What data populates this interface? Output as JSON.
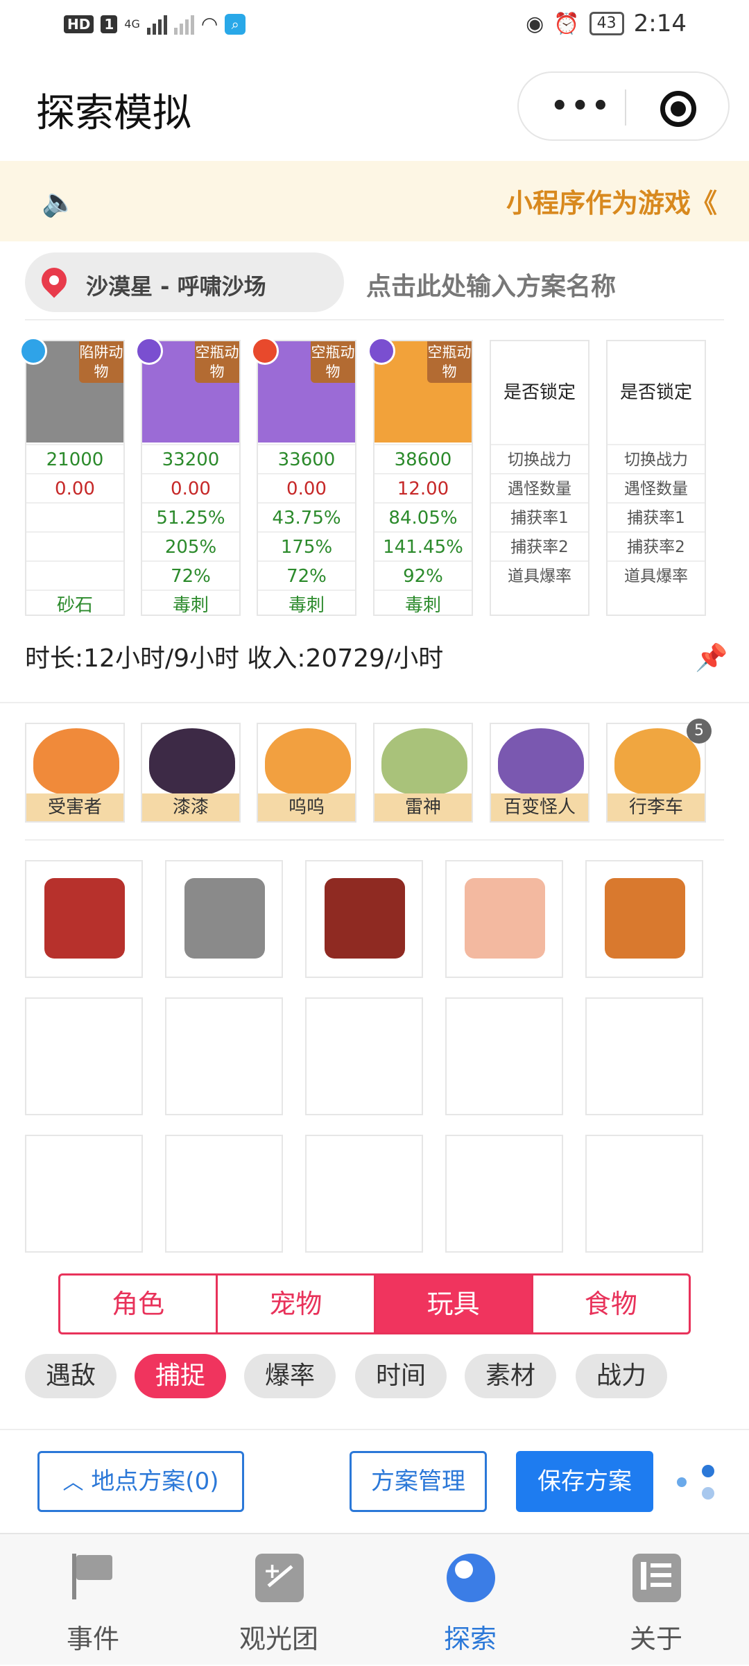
{
  "status": {
    "time": "2:14",
    "battery": "43",
    "hd": "HD",
    "sim": "1",
    "net": "4G"
  },
  "title": "探索模拟",
  "banner": {
    "text": "小程序作为游戏《"
  },
  "location": {
    "label": "沙漠星 - 呼啸沙场",
    "plan_placeholder": "点击此处输入方案名称"
  },
  "pets": [
    {
      "tag": "陷阱动物",
      "power": "21000",
      "v1": "0.00",
      "v2": "",
      "v3": "",
      "v4": "",
      "item": "砂石",
      "elem_color": "#2fa3e8",
      "bg": "#8a8a8a"
    },
    {
      "tag": "空瓶动物",
      "power": "33200",
      "v1": "0.00",
      "v2": "51.25%",
      "v3": "205%",
      "v4": "72%",
      "item": "毒刺",
      "elem_color": "#7a4fd0",
      "bg": "#9b6bd6"
    },
    {
      "tag": "空瓶动物",
      "power": "33600",
      "v1": "0.00",
      "v2": "43.75%",
      "v3": "175%",
      "v4": "72%",
      "item": "毒刺",
      "elem_color": "#e8492c",
      "bg": "#9b6bd6"
    },
    {
      "tag": "空瓶动物",
      "power": "38600",
      "v1": "12.00",
      "v2": "84.05%",
      "v3": "141.45%",
      "v4": "92%",
      "item": "毒刺",
      "elem_color": "#7a4fd0",
      "bg": "#f2a23a"
    }
  ],
  "lock_cols": [
    {
      "head": "是否锁定",
      "rows": [
        "切换战力",
        "遇怪数量",
        "捕获率1",
        "捕获率2",
        "道具爆率"
      ]
    },
    {
      "head": "是否锁定",
      "rows": [
        "切换战力",
        "遇怪数量",
        "捕获率1",
        "捕获率2",
        "道具爆率"
      ]
    }
  ],
  "summary": "时长:12小时/9小时 收入:20729/小时",
  "people": [
    {
      "name": "受害者",
      "color": "#f08a3a"
    },
    {
      "name": "漆漆",
      "color": "#3d2a46"
    },
    {
      "name": "呜呜",
      "color": "#f2a040"
    },
    {
      "name": "雷神",
      "color": "#a9c27a"
    },
    {
      "name": "百变怪人",
      "color": "#7a58b0"
    },
    {
      "name": "行李车",
      "color": "#f0a640"
    }
  ],
  "people_badge": "5",
  "tabs": [
    "角色",
    "宠物",
    "玩具",
    "食物"
  ],
  "active_tab": 2,
  "chips": [
    "遇敌",
    "捕捉",
    "爆率",
    "时间",
    "素材",
    "战力"
  ],
  "active_chip": 1,
  "actions": {
    "location_plans": "地点方案(0)",
    "manage": "方案管理",
    "save": "保存方案"
  },
  "nav": [
    "事件",
    "观光团",
    "探索",
    "关于"
  ],
  "active_nav": 2
}
